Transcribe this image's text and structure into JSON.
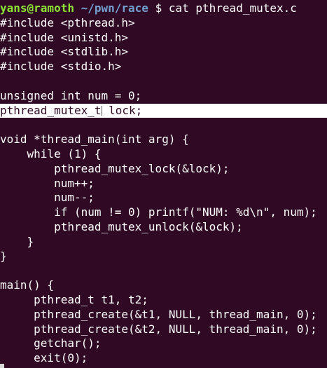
{
  "terminal": {
    "prompt_user": "yans@ramoth",
    "prompt_path": "~/pwn/race",
    "prompt_symbol": "$",
    "command": "cat pthread_mutex.c",
    "colors": {
      "background": "#300a24",
      "text": "#ffffff",
      "prompt_user": "#8ae234",
      "prompt_path": "#729fcf",
      "highlight_bg": "#ffffff",
      "highlight_fg": "#300a24"
    }
  },
  "code": {
    "lines": [
      "#include <pthread.h>",
      "#include <unistd.h>",
      "#include <stdlib.h>",
      "#include <stdio.h>",
      "",
      "unsigned int num = 0;",
      "pthread_mutex_t lock;",
      "",
      "void *thread_main(int arg) {",
      "    while (1) {",
      "        pthread_mutex_lock(&lock);",
      "        num++;",
      "        num--;",
      "        if (num != 0) printf(\"NUM: %d\\n\", num);",
      "        pthread_mutex_unlock(&lock);",
      "    }",
      "}",
      "",
      "main() {",
      "     pthread_t t1, t2;",
      "     pthread_create(&t1, NULL, thread_main, 0);",
      "     pthread_create(&t2, NULL, thread_main, 0);",
      "     getchar();",
      "     exit(0);"
    ],
    "highlight_line_index": 6,
    "highlight_prefix": "pthread_mutex_t",
    "highlight_suffix": " lock;"
  }
}
